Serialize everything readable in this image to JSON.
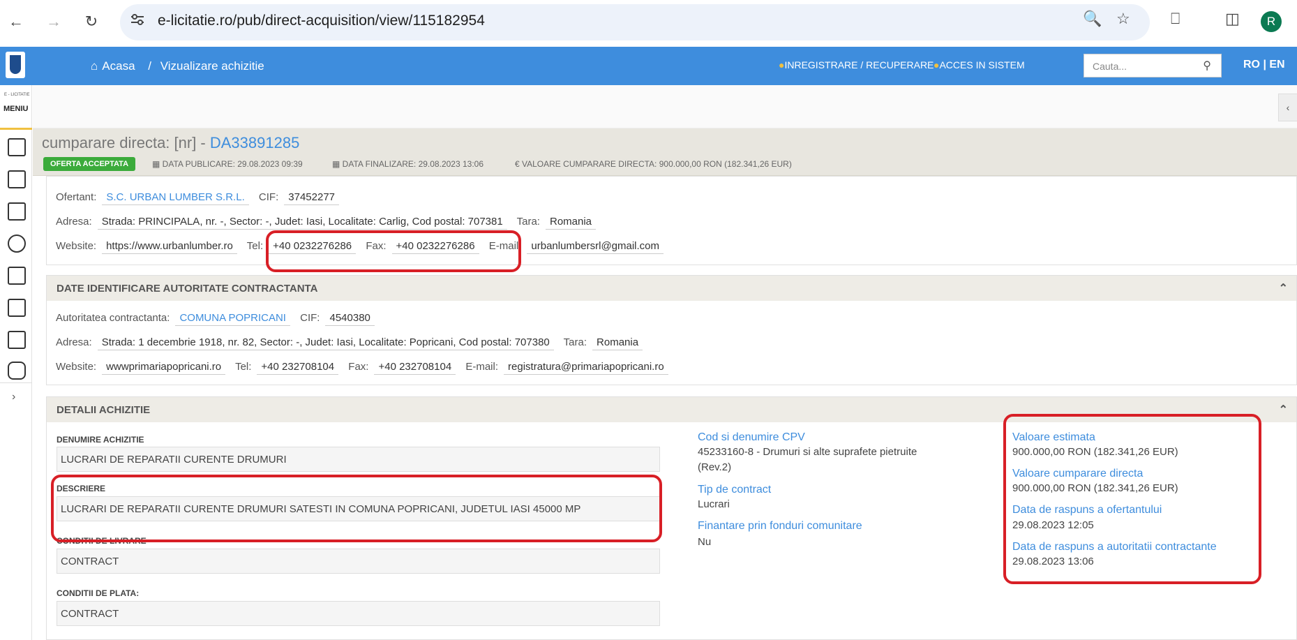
{
  "browser": {
    "url": "e-licitatie.ro/pub/direct-acquisition/view/115182954",
    "avatar_letter": "R"
  },
  "topbar": {
    "home": "Acasa",
    "separator": "/",
    "page": "Vizualizare achizitie",
    "register": "INREGISTRARE / RECUPERARE",
    "login": "ACCES IN SISTEM",
    "search_placeholder": "Cauta...",
    "lang": "RO | EN"
  },
  "sidebar": {
    "brand": "E - LICITATIE",
    "menu": "MENIU"
  },
  "header": {
    "title_prefix": "cumparare directa: [nr] - ",
    "title_code": "DA33891285",
    "badge": "OFERTA ACCEPTATA",
    "published": "DATA PUBLICARE: 29.08.2023 09:39",
    "finalized": "DATA FINALIZARE: 29.08.2023 13:06",
    "value": "VALOARE CUMPARARE DIRECTA: 900.000,00  RON (182.341,26  EUR)"
  },
  "bidder": {
    "ofertant_label": "Ofertant:",
    "ofertant": "S.C. URBAN LUMBER S.R.L.",
    "cif_label": "CIF:",
    "cif": "37452277",
    "adresa_label": "Adresa:",
    "adresa": "Strada: PRINCIPALA, nr. -, Sector: -, Judet: Iasi, Localitate: Carlig, Cod postal: 707381",
    "tara_label": "Tara:",
    "tara": "Romania",
    "website_label": "Website:",
    "website": "https://www.urbanlumber.ro",
    "tel_label": "Tel:",
    "tel": "+40 0232276286",
    "fax_label": "Fax:",
    "fax": "+40 0232276286",
    "email_label": "E-mail:",
    "email": "urbanlumbersrl@gmail.com"
  },
  "authority": {
    "heading": "DATE IDENTIFICARE AUTORITATE CONTRACTANTA",
    "name_label": "Autoritatea contractanta:",
    "name": "COMUNA POPRICANI",
    "cif_label": "CIF:",
    "cif": "4540380",
    "adresa_label": "Adresa:",
    "adresa": "Strada: 1 decembrie 1918, nr. 82, Sector: -, Judet: Iasi, Localitate: Popricani, Cod postal: 707380",
    "tara_label": "Tara:",
    "tara": "Romania",
    "website_label": "Website:",
    "website": "wwwprimariapopricani.ro",
    "tel_label": "Tel:",
    "tel": "+40 232708104",
    "fax_label": "Fax:",
    "fax": "+40 232708104",
    "email_label": "E-mail:",
    "email": "registratura@primariapopricani.ro"
  },
  "details": {
    "heading": "DETALII ACHIZITIE",
    "denumire_label": "DENUMIRE ACHIZITIE",
    "denumire": "LUCRARI DE REPARATII CURENTE DRUMURI",
    "descriere_label": "DESCRIERE",
    "descriere": "LUCRARI DE REPARATII CURENTE DRUMURI SATESTI IN COMUNA POPRICANI, JUDETUL IASI 45000 MP",
    "livrare_label": "CONDITII DE LIVRARE",
    "livrare": "CONTRACT",
    "plata_label": "CONDITII DE PLATA:",
    "plata": "CONTRACT",
    "cpv_label": "Cod si denumire CPV",
    "cpv_line1": "45233160-8 - Drumuri si alte suprafete pietruite",
    "cpv_line2": "(Rev.2)",
    "tip_label": "Tip de contract",
    "tip": "Lucrari",
    "finantare_label": "Finantare prin fonduri comunitare",
    "finantare": "Nu",
    "estimata_label": "Valoare estimata",
    "estimata": "900.000,00  RON (182.341,26  EUR)",
    "cumparare_label": "Valoare cumparare directa",
    "cumparare": "900.000,00  RON (182.341,26  EUR)",
    "raspuns_ofertant_label": "Data de raspuns a ofertantului",
    "raspuns_ofertant": "29.08.2023 12:05",
    "raspuns_autoritate_label": "Data de raspuns a autoritatii contractante",
    "raspuns_autoritate": "29.08.2023 13:06"
  }
}
